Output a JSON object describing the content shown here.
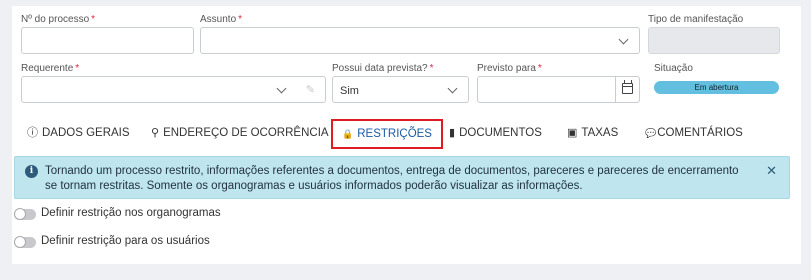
{
  "form": {
    "processo": {
      "label": "Nº do processo",
      "required": "*",
      "value": ""
    },
    "assunto": {
      "label": "Assunto",
      "required": "*",
      "value": ""
    },
    "tipo_manifestacao": {
      "label": "Tipo de manifestação",
      "value": ""
    },
    "requerente": {
      "label": "Requerente",
      "required": "*",
      "value": ""
    },
    "possui_data": {
      "label": "Possui data prevista?",
      "required": "*",
      "value": "Sim"
    },
    "previsto_para": {
      "label": "Previsto para",
      "required": "*",
      "value": ""
    },
    "situacao": {
      "label": "Situação",
      "value": "Em abertura"
    }
  },
  "tabs": [
    {
      "label": "DADOS GERAIS",
      "icon": "info-circle-icon",
      "glyph": "ⓘ"
    },
    {
      "label": "ENDEREÇO DE OCORRÊNCIA",
      "icon": "map-marker-icon",
      "glyph": "⚲"
    },
    {
      "label": "RESTRIÇÕES",
      "icon": "lock-icon",
      "glyph": "🔒",
      "active": true
    },
    {
      "label": "DOCUMENTOS",
      "icon": "file-icon",
      "glyph": "▮"
    },
    {
      "label": "TAXAS",
      "icon": "money-icon",
      "glyph": "▣"
    },
    {
      "label": "COMENTÁRIOS",
      "icon": "comment-icon",
      "glyph": "💬"
    }
  ],
  "info": {
    "text": "Tornando um processo restrito, informações referentes a documentos, entrega de documentos, pareceres e pareceres de encerramento se tornam restritas. Somente os organogramas e usuários informados poderão visualizar as informações.",
    "icon": "info-icon",
    "close": "✕"
  },
  "toggles": [
    {
      "label": "Definir restrição nos organogramas",
      "on": false
    },
    {
      "label": "Definir restrição para os usuários",
      "on": false
    }
  ],
  "colors": {
    "active_tab": "#1a5ca8",
    "highlight_border": "#e01b24",
    "info_bg": "#bfe5ef",
    "badge": "#63bfe0"
  }
}
